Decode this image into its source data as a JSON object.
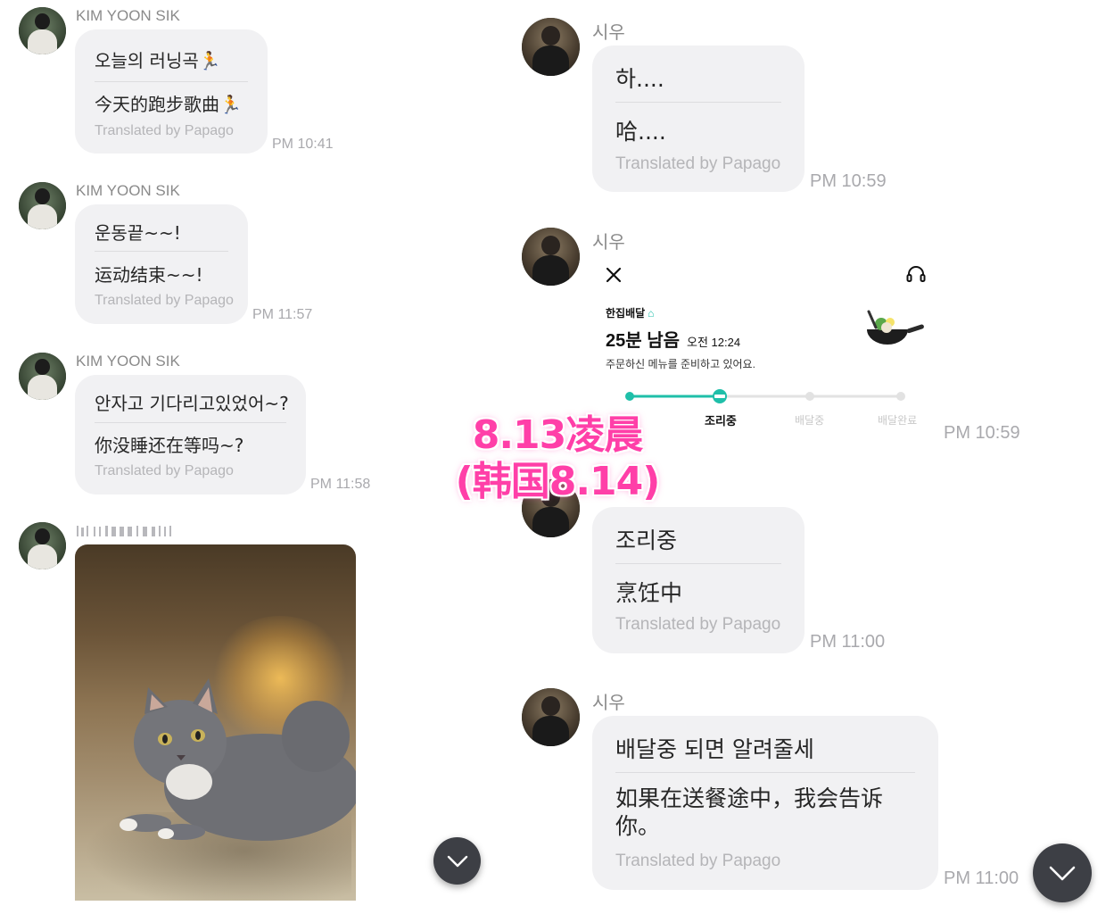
{
  "left_messages": [
    {
      "sender": "KIM YOON SIK",
      "original": "오늘의 러닝곡🏃",
      "translation": "今天的跑步歌曲🏃",
      "credit": "Translated by Papago",
      "time": "PM 10:41"
    },
    {
      "sender": "KIM YOON SIK",
      "original": "운동끝~~!",
      "translation": "运动结束~~!",
      "credit": "Translated by Papago",
      "time": "PM 11:57"
    },
    {
      "sender": "KIM YOON SIK",
      "original": "안자고 기다리고있었어~?",
      "translation": "你没睡还在等吗~?",
      "credit": "Translated by Papago",
      "time": "PM 11:58"
    }
  ],
  "right_messages": [
    {
      "sender": "시우",
      "original": "하....",
      "translation": "哈....",
      "credit": "Translated by Papago",
      "time": "PM 10:59"
    },
    {
      "sender": "시우",
      "time": "PM 10:59"
    },
    {
      "original": "조리중",
      "translation": "烹饪中",
      "credit": "Translated by Papago",
      "time": "PM 11:00"
    },
    {
      "sender": "시우",
      "original": "배달중 되면 알려줄세",
      "translation": "如果在送餐途中，我会告诉\n你。",
      "credit": "Translated by Papago",
      "time": "PM 11:00"
    }
  ],
  "delivery_card": {
    "service": "한집배달",
    "remaining": "25분 남음",
    "eta": "오전 12:24",
    "status_message": "주문하신 메뉴를 준비하고 있어요.",
    "steps": [
      "",
      "조리중",
      "배달중",
      "배달완료"
    ],
    "active_step_index": 1,
    "icons": [
      "close-icon",
      "headset-icon",
      "wok-icon"
    ]
  },
  "overlay": {
    "line1": "8.13凌晨",
    "line2": "(韩国8.14)",
    "color": "#ff3fa8"
  },
  "colors": {
    "bubble": "#f1f1f3",
    "progress": "#1fbfa9",
    "scroll_button": "#3d3f45"
  }
}
